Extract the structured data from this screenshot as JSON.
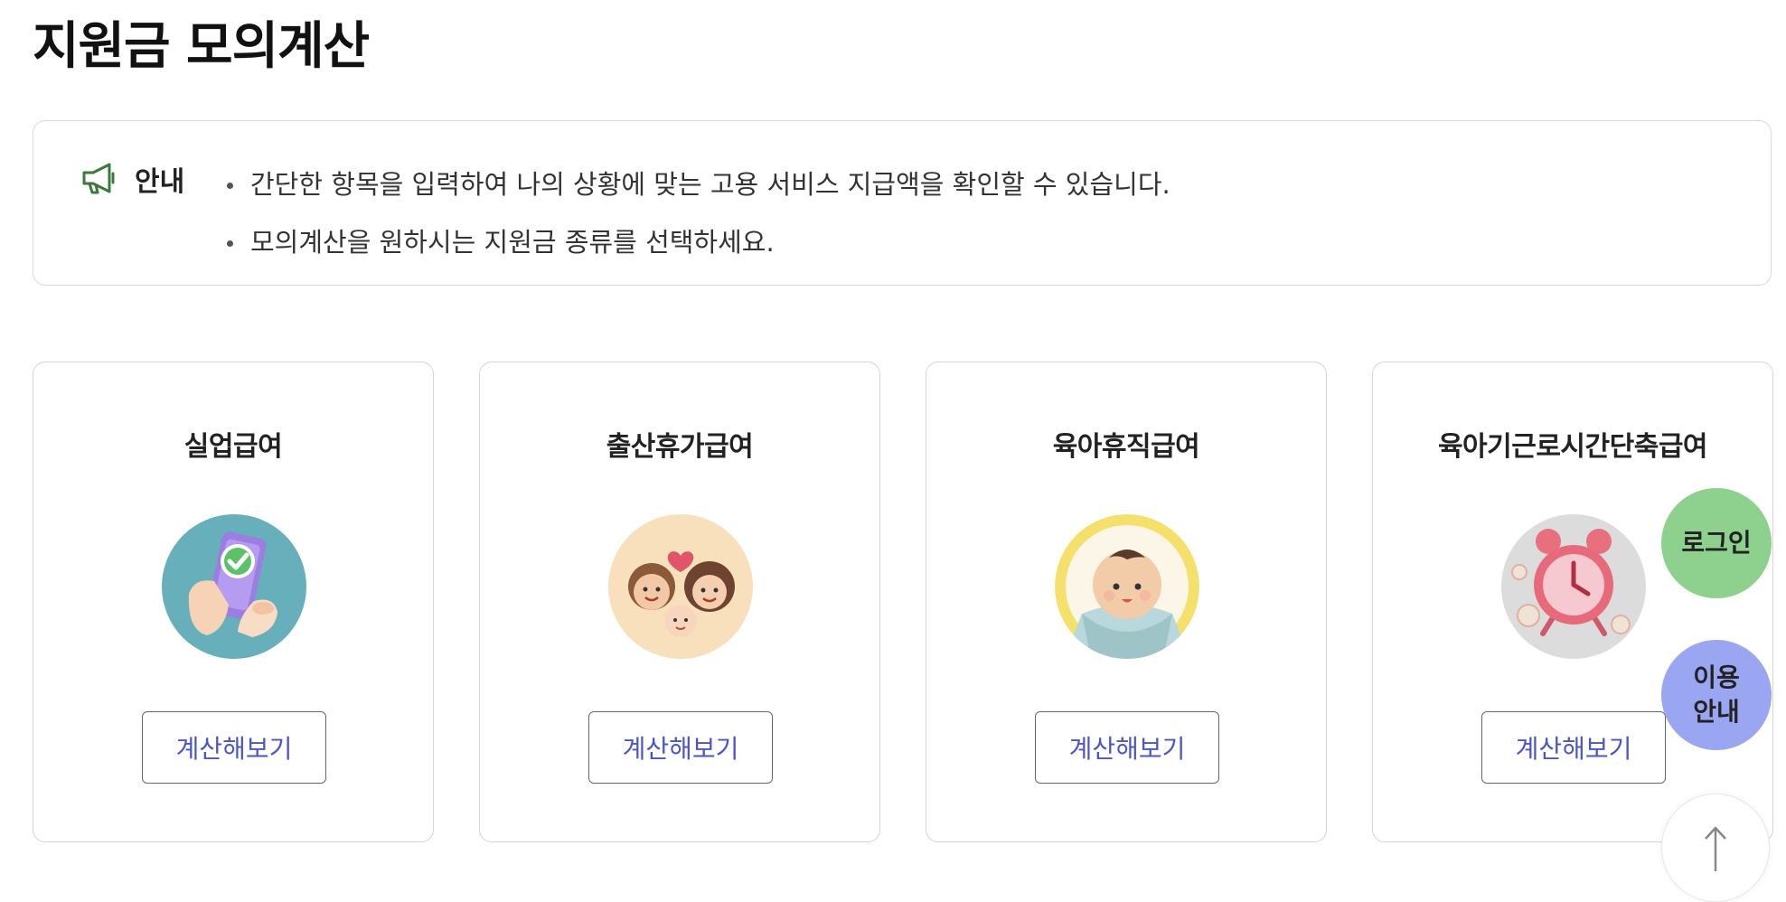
{
  "page": {
    "title": "지원금 모의계산"
  },
  "notice": {
    "label": "안내",
    "icon": "megaphone-icon",
    "items": [
      "간단한 항목을 입력하여 나의 상황에 맞는 고용 서비스 지급액을 확인할 수 있습니다.",
      "모의계산을 원하시는 지원금 종류를 선택하세요."
    ]
  },
  "cards": [
    {
      "title": "실업급여",
      "button": "계산해보기",
      "icon": "phone-check-illustration",
      "bg": "#67b0bb"
    },
    {
      "title": "출산휴가급여",
      "button": "계산해보기",
      "icon": "family-illustration",
      "bg": "#f8e0bd"
    },
    {
      "title": "육아휴직급여",
      "button": "계산해보기",
      "icon": "baby-illustration",
      "bg": "#f4e06a"
    },
    {
      "title": "육아기근로시간단축급여",
      "button": "계산해보기",
      "icon": "alarm-clock-illustration",
      "bg": "#dcdcdc"
    }
  ],
  "floating": {
    "login": "로그인",
    "guide_line1": "이용",
    "guide_line2": "안내",
    "top_icon": "arrow-up-icon"
  },
  "colors": {
    "login_bg": "#8ed08e",
    "guide_bg": "#9aa6f2",
    "button_text": "#4b55c8",
    "notice_icon": "#3a7a3a"
  }
}
